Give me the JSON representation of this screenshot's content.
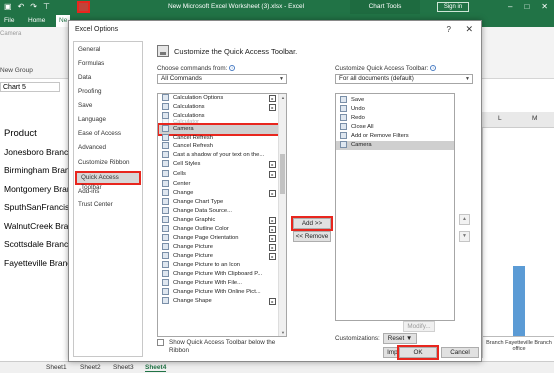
{
  "excel": {
    "doc_title": "New Microsoft Excel Worksheet (3).xlsx  -  Excel",
    "chart_tools": "Chart Tools",
    "sign_in": "Sign in",
    "tabs": [
      "File",
      "Home",
      "Ne"
    ],
    "ribbon_camera": "Camera",
    "ribbon_group": "New Group",
    "name_box": "Chart 5",
    "cells": [
      "Product",
      "Jonesboro Branch",
      "Birmingham Branch",
      "Montgomery Branch",
      "SputhSanFrancisco Branch",
      "WalnutCreek Branch",
      "Scottsdale Branch",
      "Fayetteville Branch"
    ],
    "col_letters": [
      "L",
      "M"
    ],
    "chart_label": "Branch Fayetteville Branch office",
    "sheets": [
      "Sheet1",
      "Sheet2",
      "Sheet3",
      "Sheet4"
    ]
  },
  "dialog": {
    "title": "Excel Options",
    "help": "?",
    "close": "✕",
    "nav": [
      "General",
      "Formulas",
      "Data",
      "Proofing",
      "Save",
      "Language",
      "Ease of Access",
      "Advanced",
      "Customize Ribbon",
      "Quick Access Toolbar",
      "Add-ins",
      "Trust Center"
    ],
    "nav_selected": "Quick Access Toolbar",
    "heading": "Customize the Quick Access Toolbar.",
    "choose_label": "Choose commands from:",
    "choose_value": "All Commands",
    "customize_label": "Customize Quick Access Toolbar:",
    "customize_value": "For all documents (default)",
    "commands": [
      "Calculation Options",
      "Calculations",
      "Calculations",
      "Calculator",
      "Camera",
      "Cancel Refresh",
      "Cancel Refresh",
      "Cast a shadow of your text on the...",
      "Cell Styles",
      "Cells",
      "Center",
      "Change",
      "Change Chart Type",
      "Change Data Source...",
      "Change Graphic",
      "Change Outline Color",
      "Change Page Orientation",
      "Change Picture",
      "Change Picture",
      "Change Picture to an Icon",
      "Change Picture With Clipboard P...",
      "Change Picture With File...",
      "Change Picture With Online Pict...",
      "Change Shape"
    ],
    "selected_command": "Camera",
    "toolbar_items": [
      "Save",
      "Undo",
      "Redo",
      "Close All",
      "Add or Remove Filters",
      "Camera"
    ],
    "add_button": "Add >>",
    "remove_button": "<< Remove",
    "modify_button": "Modify...",
    "show_below": "Show Quick Access Toolbar below the Ribbon",
    "customizations_label": "Customizations:",
    "reset_button": "Reset ▼",
    "import_export_button": "Import/Export ▼",
    "ok": "OK",
    "cancel": "Cancel"
  },
  "colors": {
    "excel_green": "#217346",
    "highlight_red": "#e8261e",
    "chart_bar": "#5b9bd5"
  }
}
